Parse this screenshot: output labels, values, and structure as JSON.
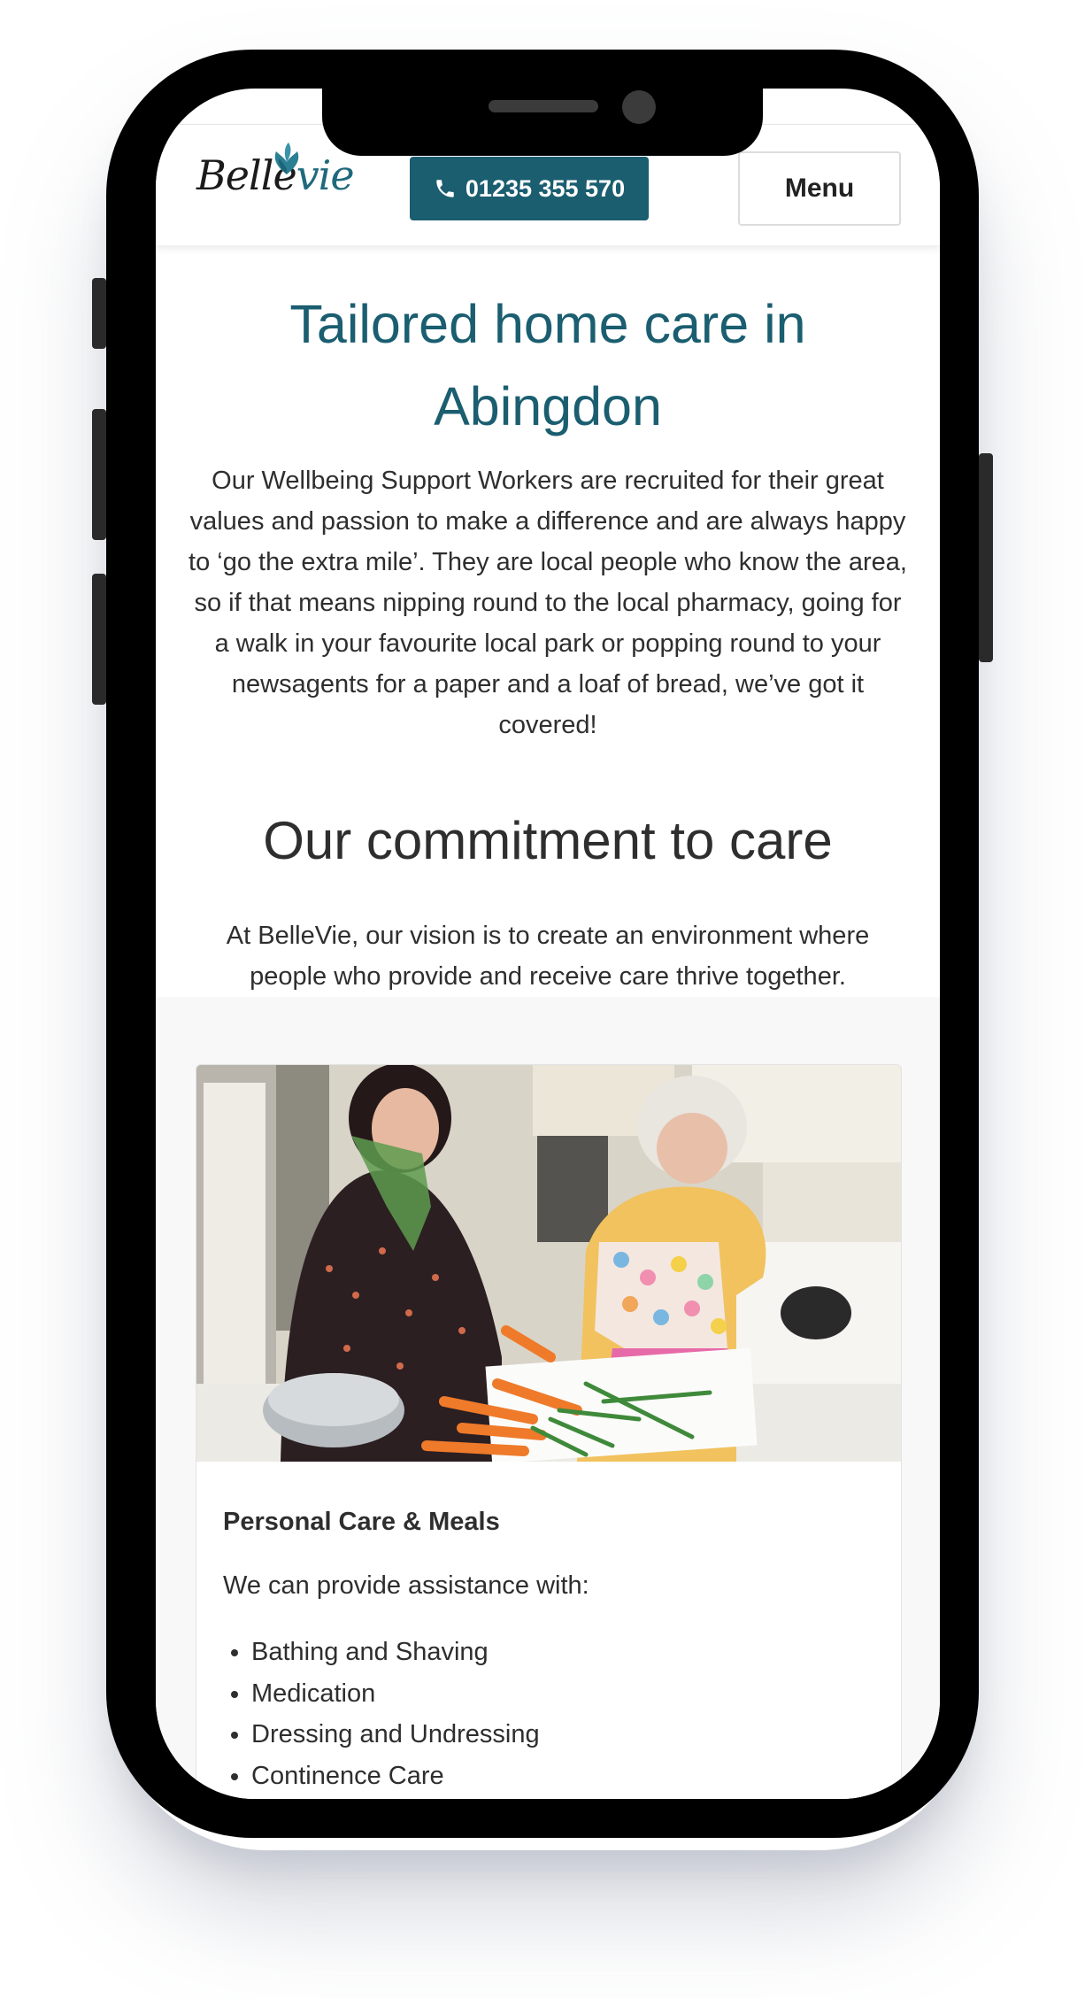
{
  "header": {
    "logo_text_main": "Belle",
    "logo_text_accent": "vie",
    "phone_icon": "phone-icon",
    "phone_number": "01235 355 570",
    "menu_label": "Menu"
  },
  "hero": {
    "title": "Tailored home care in Abingdon",
    "body": "Our Wellbeing Support Workers are recruited for their great values and passion to make a difference and are always happy to ‘go the extra mile’. They are local people who know the area, so if that means nipping round to the local pharmacy, going for a walk in your favourite local park or popping round to your newsagents for a paper and a loaf of bread, we’ve got it covered!"
  },
  "commitment": {
    "title": "Our commitment to care",
    "body": "At BelleVie, our vision is to create an environment where people who provide and receive care thrive together."
  },
  "card": {
    "heading": "Personal Care & Meals",
    "intro": "We can provide assistance with:",
    "items": [
      "Bathing and Shaving",
      "Medication",
      "Dressing and Undressing",
      "Continence Care"
    ]
  },
  "colors": {
    "brand_teal": "#1a5e70",
    "text_dark": "#2e2e2e",
    "device_frame": "#000000"
  }
}
